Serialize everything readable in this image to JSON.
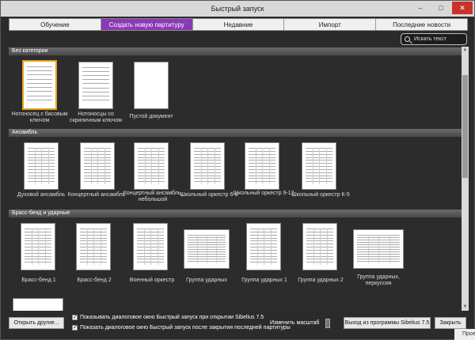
{
  "window": {
    "title": "Быстрый запуск",
    "min": "–",
    "max": "□",
    "close": "✕"
  },
  "tabs": [
    {
      "label": "Обучение"
    },
    {
      "label": "Создать новую партитуру"
    },
    {
      "label": "Недавние"
    },
    {
      "label": "Импорт"
    },
    {
      "label": "Последние новости"
    }
  ],
  "search": {
    "placeholder": "Искать текст"
  },
  "sections": [
    {
      "title": "Без категории",
      "items": [
        {
          "label": "Нотоносец с басовым ключом"
        },
        {
          "label": "Нотоносцы со скрипичным ключом"
        },
        {
          "label": "Пустой документ"
        }
      ]
    },
    {
      "title": "Ансамбль",
      "items": [
        {
          "label": "Духовой ансамбль"
        },
        {
          "label": "Концертный ансамбль"
        },
        {
          "label": "Концертный ансамбль, небольшой"
        },
        {
          "label": "Школьный оркестр 6-8"
        },
        {
          "label": "Школьный оркестр 9-12"
        },
        {
          "label": "Школьный оркестр К-5"
        }
      ]
    },
    {
      "title": "Брасс-бенд и ударные",
      "items": [
        {
          "label": "Брасс-бенд 1"
        },
        {
          "label": "Брасс-бенд 2"
        },
        {
          "label": "Военный оркестр"
        },
        {
          "label": "Группа ударных"
        },
        {
          "label": "Группа ударных 1"
        },
        {
          "label": "Группа ударных 2"
        },
        {
          "label": "Группа ударных, перкуссия"
        }
      ]
    }
  ],
  "footer": {
    "open_other": "Открыть другие...",
    "check_startup": "Показывать диалоговое окно Быстрый запуск при открытии Sibelius 7.5",
    "check_close": "Показать диалоговое окно Быстрый запуск после закрытия последней партитуры",
    "zoom_label": "Изменить масштаб",
    "exit": "Выход из программы Sibelius 7.5",
    "close": "Закрыть"
  },
  "taskbar": {
    "peek": "Прое"
  }
}
